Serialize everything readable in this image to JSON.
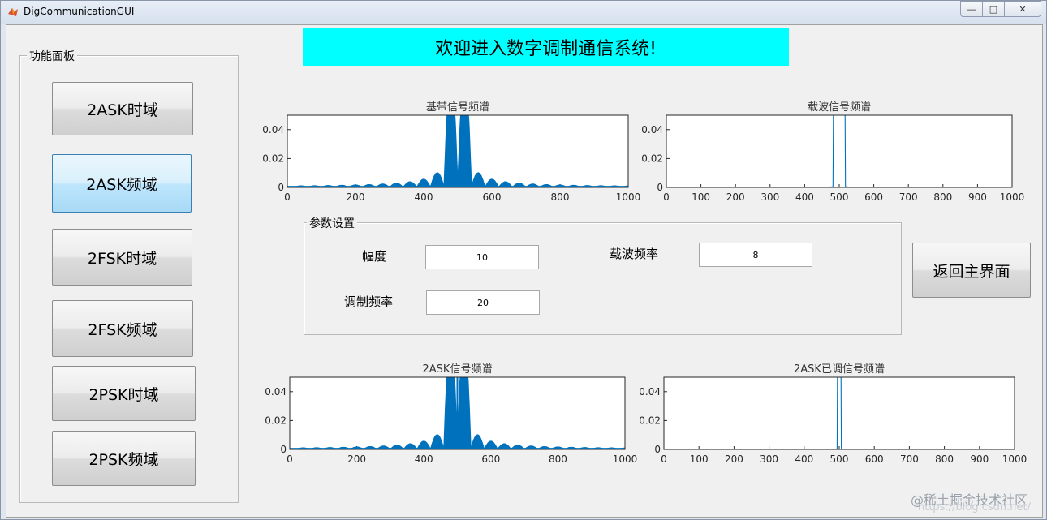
{
  "window": {
    "title": "DigCommunicationGUI"
  },
  "banner": {
    "text": "欢迎进入数字调制通信系统!"
  },
  "function_panel": {
    "title": "功能面板",
    "buttons": [
      "2ASK时域",
      "2ASK频域",
      "2FSK时域",
      "2FSK频域",
      "2PSK时域",
      "2PSK频域"
    ],
    "active_index": 1
  },
  "params": {
    "title": "参数设置",
    "amplitude_label": "幅度",
    "amplitude_value": "10",
    "carrier_freq_label": "载波频率",
    "carrier_freq_value": "8",
    "mod_freq_label": "调制频率",
    "mod_freq_value": "20"
  },
  "back_button": "返回主界面",
  "watermark": "@稀土掘金技术社区",
  "watermark_url": "https://blog.csdn.net/",
  "colors": {
    "banner": "#00ffff",
    "line": "#0072bd"
  },
  "chart_data": [
    {
      "type": "line",
      "title": "基带信号频谱",
      "xlim": [
        0,
        1000
      ],
      "ylim": [
        0,
        0.05
      ],
      "xticks": [
        "0",
        "200",
        "400",
        "600",
        "800",
        "1000"
      ],
      "yticks": [
        "0",
        "0.02",
        "0.04"
      ],
      "shape": "sinc-spectrum",
      "center": 500,
      "null_spacing": 40,
      "peak_halfwidth": 30,
      "clip": 0.05
    },
    {
      "type": "line",
      "title": "载波信号频谱",
      "xlim": [
        0,
        1000
      ],
      "ylim": [
        0,
        0.05
      ],
      "xticks": [
        "0",
        "100",
        "200",
        "300",
        "400",
        "500",
        "600",
        "700",
        "800",
        "900",
        "1000"
      ],
      "yticks": [
        "0",
        "0.02",
        "0.04"
      ],
      "shape": "narrow-peak",
      "center": 500,
      "peak_halfwidth": 18,
      "clip": 0.05
    },
    {
      "type": "line",
      "title": "2ASK信号频谱",
      "xlim": [
        0,
        1000
      ],
      "ylim": [
        0,
        0.05
      ],
      "xticks": [
        "0",
        "200",
        "400",
        "600",
        "800",
        "1000"
      ],
      "yticks": [
        "0",
        "0.02",
        "0.04"
      ],
      "shape": "sinc-spectrum-carrier",
      "center": 500,
      "null_spacing": 40,
      "peak_halfwidth": 30,
      "clip": 0.05
    },
    {
      "type": "line",
      "title": "2ASK已调信号频谱",
      "xlim": [
        0,
        1000
      ],
      "ylim": [
        0,
        0.05
      ],
      "xticks": [
        "0",
        "100",
        "200",
        "300",
        "400",
        "500",
        "600",
        "700",
        "800",
        "900",
        "1000"
      ],
      "yticks": [
        "0",
        "0.02",
        "0.04"
      ],
      "shape": "narrow-peak",
      "center": 500,
      "peak_halfwidth": 6,
      "clip": 0.05
    }
  ]
}
